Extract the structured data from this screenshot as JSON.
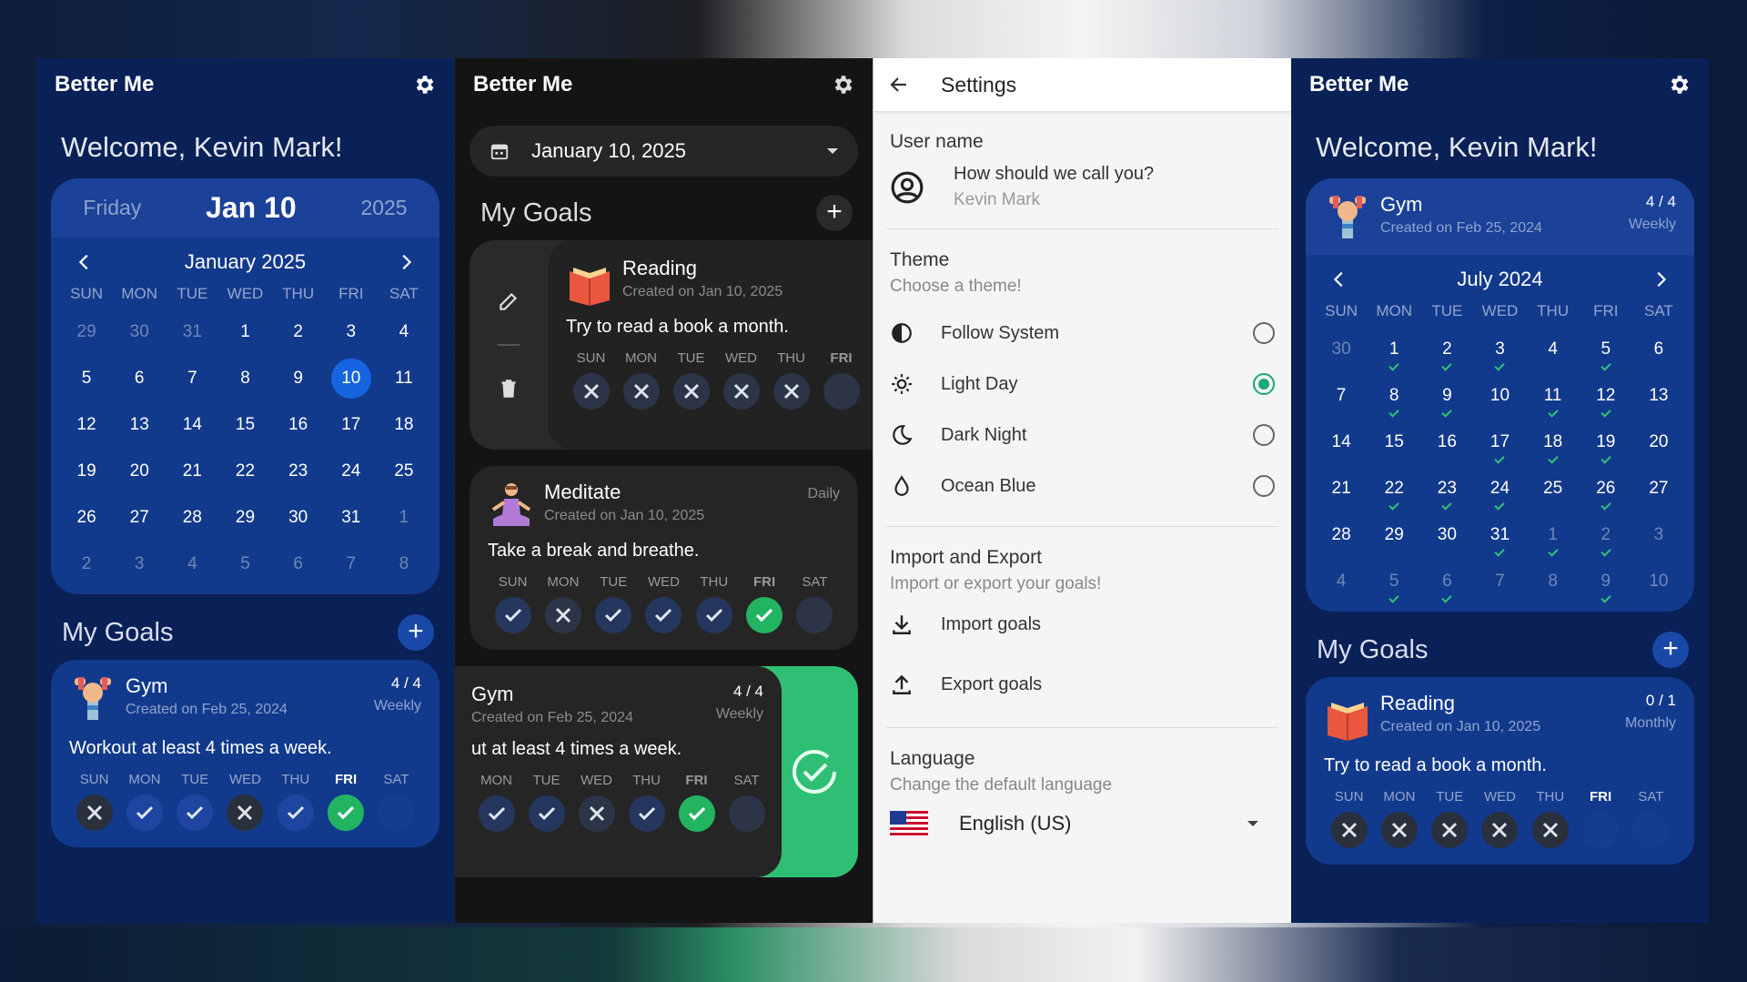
{
  "app_title": "Better Me",
  "welcome": "Welcome, Kevin Mark!",
  "panel1": {
    "date_header": {
      "day": "Friday",
      "date": "Jan 10",
      "year": "2025"
    },
    "calendar": {
      "month": "January 2025",
      "dow": [
        "SUN",
        "MON",
        "TUE",
        "WED",
        "THU",
        "FRI",
        "SAT"
      ],
      "weeks": [
        [
          "29",
          "30",
          "31",
          "1",
          "2",
          "3",
          "4"
        ],
        [
          "5",
          "6",
          "7",
          "8",
          "9",
          "10",
          "11"
        ],
        [
          "12",
          "13",
          "14",
          "15",
          "16",
          "17",
          "18"
        ],
        [
          "19",
          "20",
          "21",
          "22",
          "23",
          "24",
          "25"
        ],
        [
          "26",
          "27",
          "28",
          "29",
          "30",
          "31",
          "1"
        ],
        [
          "2",
          "3",
          "4",
          "5",
          "6",
          "7",
          "8"
        ]
      ],
      "selected": "10"
    },
    "goals_title": "My Goals",
    "goal": {
      "name": "Gym",
      "created": "Created on Feb 25, 2024",
      "count": "4 / 4",
      "freq": "Weekly",
      "desc": "Workout at least 4 times a week.",
      "days": [
        "SUN",
        "MON",
        "TUE",
        "WED",
        "THU",
        "FRI",
        "SAT"
      ],
      "states": [
        "x",
        "ok",
        "ok",
        "x",
        "ok",
        "done",
        "empty"
      ]
    }
  },
  "panel2": {
    "date_value": "January 10, 2025",
    "goals_title": "My Goals",
    "reading": {
      "name": "Reading",
      "created": "Created on Jan 10, 2025",
      "desc": "Try to read a book a month.",
      "days": [
        "SUN",
        "MON",
        "TUE",
        "WED",
        "THU",
        "FRI"
      ],
      "states": [
        "x",
        "x",
        "x",
        "x",
        "x",
        "empty"
      ]
    },
    "meditate": {
      "name": "Meditate",
      "created": "Created on Jan 10, 2025",
      "freq": "Daily",
      "desc": "Take a break and breathe.",
      "days": [
        "SUN",
        "MON",
        "TUE",
        "WED",
        "THU",
        "FRI",
        "SAT"
      ],
      "states": [
        "ok",
        "x",
        "ok",
        "ok",
        "ok",
        "done",
        "empty"
      ]
    },
    "gym": {
      "name": "Gym",
      "created": "Created on Feb 25, 2024",
      "count": "4 / 4",
      "freq": "Weekly",
      "desc": "ut at least 4 times a week.",
      "days": [
        "MON",
        "TUE",
        "WED",
        "THU",
        "FRI",
        "SAT"
      ],
      "states": [
        "ok",
        "ok",
        "x",
        "ok",
        "done",
        "empty"
      ]
    }
  },
  "settings": {
    "title": "Settings",
    "username_head": "User name",
    "username_prompt": "How should we call you?",
    "username_value": "Kevin Mark",
    "theme_head": "Theme",
    "theme_sub": "Choose a theme!",
    "themes": [
      "Follow System",
      "Light Day",
      "Dark Night",
      "Ocean Blue"
    ],
    "theme_selected": "Light Day",
    "ie_head": "Import and Export",
    "ie_sub": "Import or export your goals!",
    "import_label": "Import goals",
    "export_label": "Export goals",
    "lang_head": "Language",
    "lang_sub": "Change the default language",
    "lang_value": "English (US)"
  },
  "panel4": {
    "gym": {
      "name": "Gym",
      "created": "Created on Feb 25, 2024",
      "count": "4 / 4",
      "freq": "Weekly"
    },
    "calendar": {
      "month": "July 2024",
      "dow": [
        "SUN",
        "MON",
        "TUE",
        "WED",
        "THU",
        "FRI",
        "SAT"
      ],
      "weeks": [
        [
          "30",
          "1",
          "2",
          "3",
          "4",
          "5",
          "6"
        ],
        [
          "7",
          "8",
          "9",
          "10",
          "11",
          "12",
          "13"
        ],
        [
          "14",
          "15",
          "16",
          "17",
          "18",
          "19",
          "20"
        ],
        [
          "21",
          "22",
          "23",
          "24",
          "25",
          "26",
          "27"
        ],
        [
          "28",
          "29",
          "30",
          "31",
          "1",
          "2",
          "3"
        ],
        [
          "4",
          "5",
          "6",
          "7",
          "8",
          "9",
          "10"
        ]
      ],
      "ticks": [
        [
          0,
          1,
          1,
          1,
          0,
          1,
          0
        ],
        [
          0,
          1,
          1,
          0,
          1,
          1,
          0
        ],
        [
          0,
          0,
          0,
          1,
          1,
          1,
          0
        ],
        [
          0,
          1,
          1,
          1,
          0,
          1,
          0
        ],
        [
          0,
          0,
          0,
          1,
          1,
          1,
          0
        ],
        [
          0,
          1,
          1,
          0,
          0,
          1,
          0
        ]
      ]
    },
    "goals_title": "My Goals",
    "reading": {
      "name": "Reading",
      "created": "Created on Jan 10, 2025",
      "count": "0 / 1",
      "freq": "Monthly",
      "desc": "Try to read a book a month.",
      "days": [
        "SUN",
        "MON",
        "TUE",
        "WED",
        "THU",
        "FRI",
        "SAT"
      ],
      "states": [
        "x",
        "x",
        "x",
        "x",
        "x",
        "empty",
        "empty"
      ]
    }
  },
  "colors": {
    "accent_green": "#22b461",
    "selected_blue": "#1565e0",
    "ocean_bg": "#0a2157"
  }
}
